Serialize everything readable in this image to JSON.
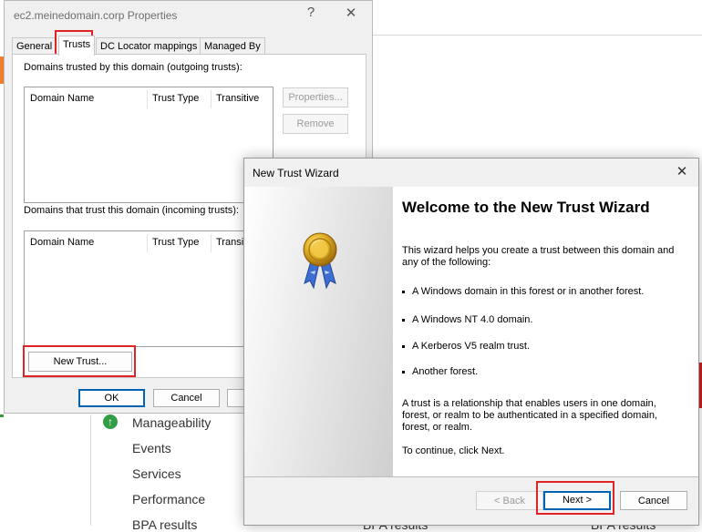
{
  "background": {
    "nav_items": [
      "Manageability",
      "Events",
      "Services",
      "Performance",
      "BPA results"
    ],
    "bpa_labels": [
      "BPA results",
      "BPA results"
    ]
  },
  "properties_dialog": {
    "title": "ec2.meinedomain.corp Properties",
    "help_glyph": "?",
    "close_glyph": "✕",
    "tabs": [
      "General",
      "Trusts",
      "DC Locator mappings",
      "Managed By"
    ],
    "active_tab": "Trusts",
    "outgoing_label": "Domains trusted by this domain (outgoing trusts):",
    "incoming_label": "Domains that trust this domain (incoming trusts):",
    "columns": [
      "Domain Name",
      "Trust Type",
      "Transitive"
    ],
    "incoming_columns": [
      "Domain Name",
      "Trust Type",
      "Transiti"
    ],
    "properties_button": "Properties...",
    "remove_button": "Remove",
    "new_trust_button": "New Trust...",
    "ok_button": "OK",
    "cancel_button": "Cancel"
  },
  "wizard": {
    "title": "New Trust Wizard",
    "close_glyph": "✕",
    "heading": "Welcome to the New Trust Wizard",
    "intro": "This wizard helps you create a trust between this domain and any of the following:",
    "bullets": [
      "A Windows domain in this forest or in another forest.",
      "A Windows NT 4.0 domain.",
      "A Kerberos V5 realm trust.",
      "Another forest."
    ],
    "description": "A trust is a relationship that enables users in one domain, forest, or realm to be authenticated in a specified domain, forest, or realm.",
    "continue_text": "To continue, click Next.",
    "back_button": "< Back",
    "next_button": "Next >",
    "cancel_button": "Cancel"
  },
  "colors": {
    "highlight": "#e02424",
    "default_button_border": "#0063b1",
    "status_green": "#2f9e44"
  }
}
